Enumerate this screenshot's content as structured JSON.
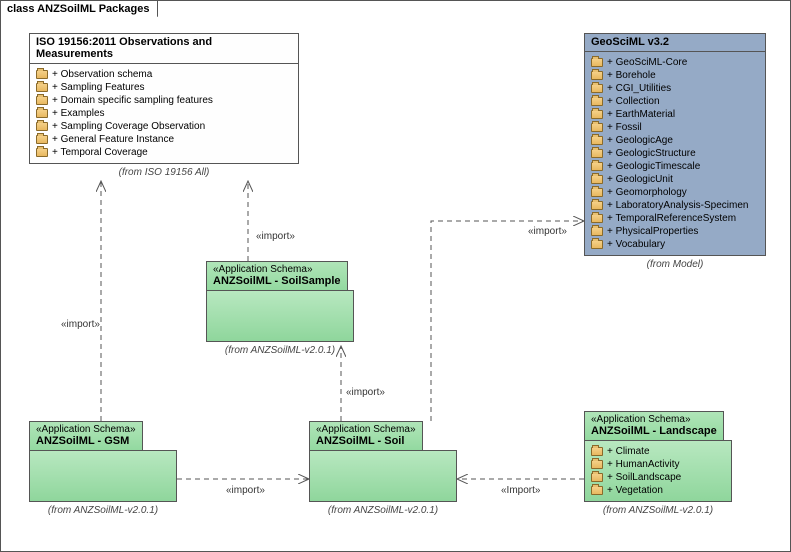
{
  "frame_title": "class ANZSoilML Packages",
  "packages": {
    "iso": {
      "title": "ISO 19156:2011 Observations and Measurements",
      "items": [
        "Observation schema",
        "Sampling Features",
        "Domain specific sampling features",
        "Examples",
        "Sampling Coverage Observation",
        "General Feature Instance",
        "Temporal Coverage"
      ],
      "note": "(from ISO 19156 All)"
    },
    "geo": {
      "title": "GeoSciML v3.2",
      "items": [
        "GeoSciML-Core",
        "Borehole",
        "CGI_Utilities",
        "Collection",
        "EarthMaterial",
        "Fossil",
        "GeologicAge",
        "GeologicStructure",
        "GeologicTimescale",
        "GeologicUnit",
        "Geomorphology",
        "LaboratoryAnalysis-Specimen",
        "TemporalReferenceSystem",
        "PhysicalProperties",
        "Vocabulary"
      ],
      "note": "(from Model)"
    },
    "soilsample": {
      "stereo": "«Application Schema»",
      "title": "ANZSoilML - SoilSample",
      "note": "(from ANZSoilML-v2.0.1)"
    },
    "gsm": {
      "stereo": "«Application Schema»",
      "title": "ANZSoilML - GSM",
      "note": "(from ANZSoilML-v2.0.1)"
    },
    "soil": {
      "stereo": "«Application Schema»",
      "title": "ANZSoilML - Soil",
      "note": "(from ANZSoilML-v2.0.1)"
    },
    "landscape": {
      "stereo": "«Application Schema»",
      "title": "ANZSoilML - Landscape",
      "items": [
        "Climate",
        "HumanActivity",
        "SoilLandscape",
        "Vegetation"
      ],
      "note": "(from ANZSoilML-v2.0.1)"
    }
  },
  "connectors": {
    "import1": "«import»",
    "import2": "«import»",
    "import3": "«import»",
    "import4": "«import»",
    "import5": "«import»",
    "import6": "«Import»"
  }
}
